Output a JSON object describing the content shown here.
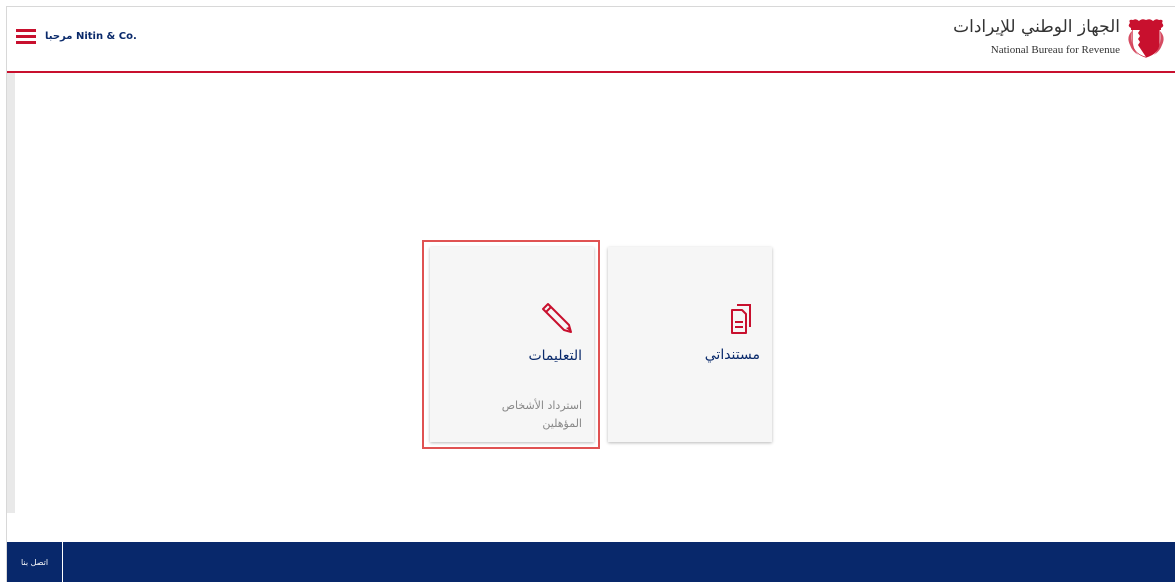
{
  "header": {
    "welcome_text": "مرحبا Nitin & Co.",
    "brand_arabic": "الجهاز الوطني للإيرادات",
    "brand_english": "National Bureau for Revenue"
  },
  "tiles": {
    "documents": {
      "title": "مستنداتي",
      "icon": "document-icon"
    },
    "instructions": {
      "title": "التعليمات",
      "subtitle": "استرداد الأشخاص المؤهلين",
      "icon": "pencil-icon"
    }
  },
  "footer": {
    "contact_label": "اتصل بنا"
  },
  "colors": {
    "brand_red": "#c8102e",
    "navy": "#08286b",
    "title_blue": "#0a2a6b",
    "highlight": "#e05252"
  }
}
